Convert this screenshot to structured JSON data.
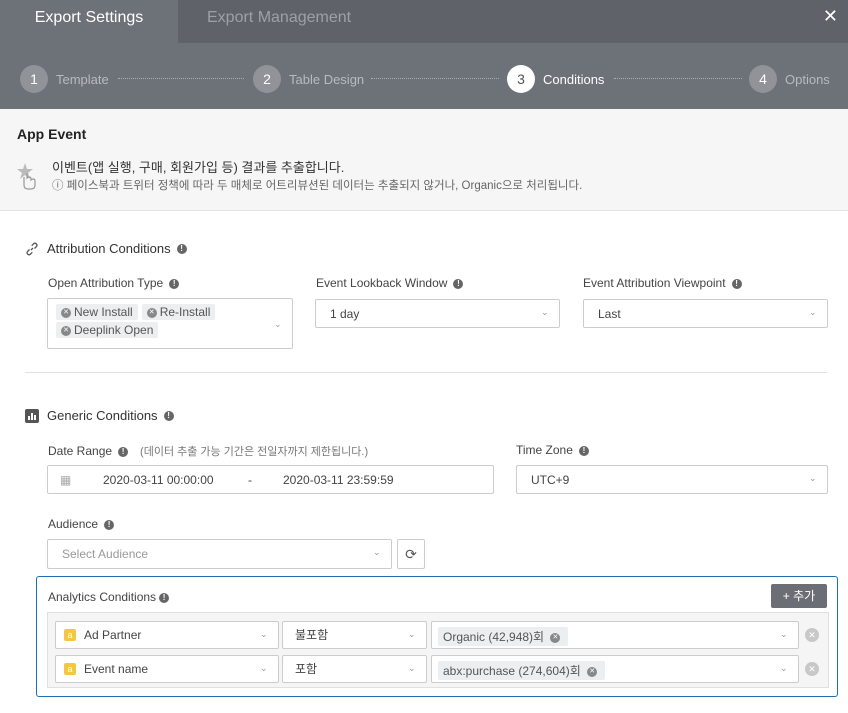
{
  "tabs": [
    "Export Settings",
    "Export Management"
  ],
  "close": "✕",
  "steps": [
    {
      "num": "1",
      "label": "Template"
    },
    {
      "num": "2",
      "label": "Table Design"
    },
    {
      "num": "3",
      "label": "Conditions"
    },
    {
      "num": "4",
      "label": "Options"
    }
  ],
  "event": {
    "title": "App Event",
    "desc": "이벤트(앱 실행, 구매, 회원가입 등) 결과를 추출합니다.",
    "note": "ⓘ 페이스북과 트위터 정책에 따라 두 매체로 어트리뷰션된 데이터는 추출되지 않거나, Organic으로 처리됩니다."
  },
  "attribution": {
    "title": "Attribution Conditions",
    "open_type_label": "Open Attribution Type",
    "open_types": [
      "New Install",
      "Re-Install",
      "Deeplink Open"
    ],
    "lookback_label": "Event Lookback Window",
    "lookback_value": "1 day",
    "viewpoint_label": "Event Attribution Viewpoint",
    "viewpoint_value": "Last"
  },
  "generic": {
    "title": "Generic Conditions",
    "date_label": "Date Range",
    "date_hint": "(데이터 추출 가능 기간은 전일자까지 제한됩니다.)",
    "date_start": "2020-03-11 00:00:00",
    "date_sep": "-",
    "date_end": "2020-03-11 23:59:59",
    "tz_label": "Time Zone",
    "tz_value": "UTC+9",
    "audience_label": "Audience",
    "audience_placeholder": "Select Audience",
    "refresh": "⟳"
  },
  "analytics": {
    "title": "Analytics Conditions",
    "add": "+ 추가",
    "rows": [
      {
        "field": "Ad Partner",
        "op": "불포함",
        "value": "Organic (42,948)회"
      },
      {
        "field": "Event name",
        "op": "포함",
        "value": "abx:purchase (274,604)회"
      }
    ]
  }
}
